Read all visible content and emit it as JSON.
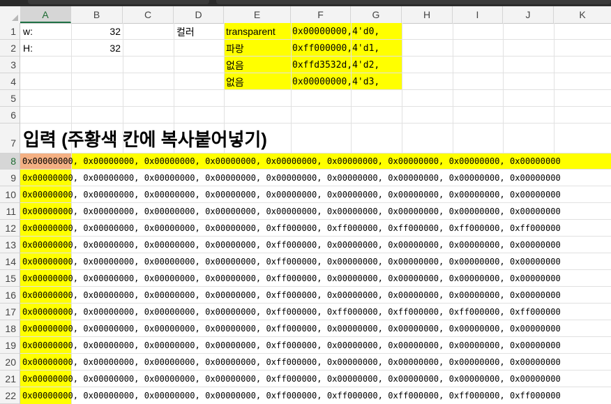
{
  "columns": [
    "A",
    "B",
    "C",
    "D",
    "E",
    "F",
    "G",
    "H",
    "I",
    "J",
    "K"
  ],
  "rows": [
    "1",
    "2",
    "3",
    "4",
    "5",
    "6",
    "7",
    "8",
    "9",
    "10",
    "11",
    "12",
    "13",
    "14",
    "15",
    "16",
    "17",
    "18",
    "19",
    "20",
    "21",
    "22"
  ],
  "cells": {
    "A1": "w:",
    "B1": "32",
    "A2": "H:",
    "B2": "32",
    "D1": "컬러",
    "E1": "transparent",
    "E2": "파랑",
    "E3": "없음",
    "E4": "없음",
    "F1": "0x00000000,4'd0,",
    "F2": "0xff000000,4'd1,",
    "F3": "0xffd3532d,4'd2,",
    "F4": "0x00000000,4'd3,"
  },
  "title": "입력 (주황색 칸에 복사붙어넣기)",
  "data_rows": [
    "0x00000000, 0x00000000, 0x00000000, 0x00000000, 0x00000000, 0x00000000, 0x00000000, 0x00000000, 0x00000000",
    "0x00000000, 0x00000000, 0x00000000, 0x00000000, 0x00000000, 0x00000000, 0x00000000, 0x00000000, 0x00000000",
    "0x00000000, 0x00000000, 0x00000000, 0x00000000, 0x00000000, 0x00000000, 0x00000000, 0x00000000, 0x00000000",
    "0x00000000, 0x00000000, 0x00000000, 0x00000000, 0x00000000, 0x00000000, 0x00000000, 0x00000000, 0x00000000",
    "0x00000000, 0x00000000, 0x00000000, 0x00000000, 0xff000000, 0xff000000, 0xff000000, 0xff000000, 0xff000000",
    "0x00000000, 0x00000000, 0x00000000, 0x00000000, 0xff000000, 0x00000000, 0x00000000, 0x00000000, 0x00000000",
    "0x00000000, 0x00000000, 0x00000000, 0x00000000, 0xff000000, 0x00000000, 0x00000000, 0x00000000, 0x00000000",
    "0x00000000, 0x00000000, 0x00000000, 0x00000000, 0xff000000, 0x00000000, 0x00000000, 0x00000000, 0x00000000",
    "0x00000000, 0x00000000, 0x00000000, 0x00000000, 0xff000000, 0x00000000, 0x00000000, 0x00000000, 0x00000000",
    "0x00000000, 0x00000000, 0x00000000, 0x00000000, 0xff000000, 0xff000000, 0xff000000, 0xff000000, 0xff000000",
    "0x00000000, 0x00000000, 0x00000000, 0x00000000, 0xff000000, 0x00000000, 0x00000000, 0x00000000, 0x00000000",
    "0x00000000, 0x00000000, 0x00000000, 0x00000000, 0xff000000, 0x00000000, 0x00000000, 0x00000000, 0x00000000",
    "0x00000000, 0x00000000, 0x00000000, 0x00000000, 0xff000000, 0x00000000, 0x00000000, 0x00000000, 0x00000000",
    "0x00000000, 0x00000000, 0x00000000, 0x00000000, 0xff000000, 0x00000000, 0x00000000, 0x00000000, 0x00000000",
    "0x00000000, 0x00000000, 0x00000000, 0x00000000, 0xff000000, 0xff000000, 0xff000000, 0xff000000, 0xff000000"
  ],
  "colors": {
    "yellow": "#ffff00",
    "orange_selection": "#f4b083",
    "header_bg": "#f3f3f3",
    "selected_header": "#1e7145"
  },
  "selected_cell": "A8"
}
